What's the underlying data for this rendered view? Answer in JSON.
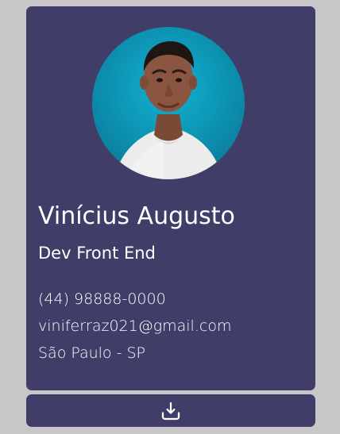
{
  "profile": {
    "name": "Vinícius Augusto",
    "role": "Dev Front End",
    "phone": "(44) 98888-0000",
    "email": "viniferraz021@gmail.com",
    "location": "São Paulo - SP"
  },
  "icons": {
    "download": "download-icon"
  },
  "colors": {
    "background": "#c9c6ca",
    "card": "#403d69",
    "text": "#ffffff",
    "avatar_background": "#0d95b5"
  }
}
